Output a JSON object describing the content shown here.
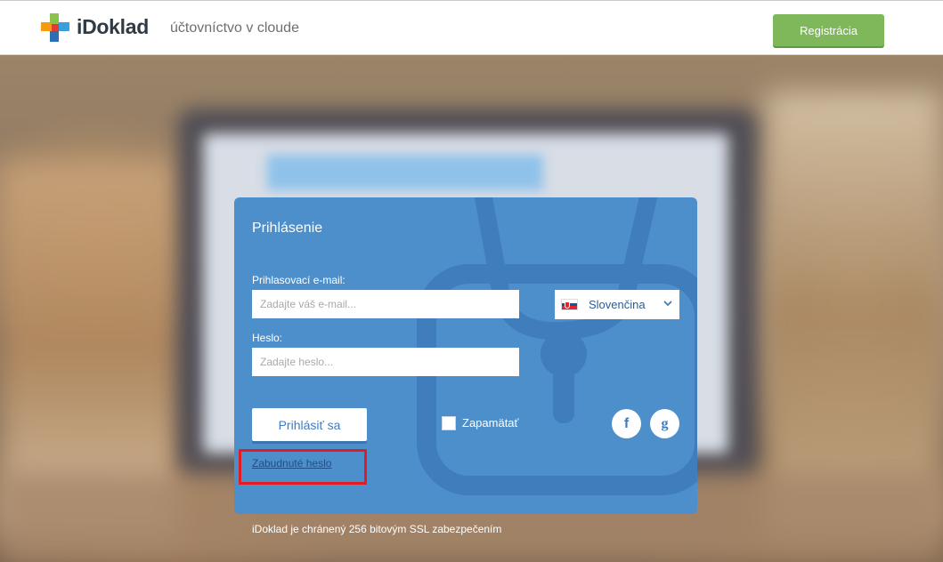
{
  "header": {
    "brand": "iDoklad",
    "tagline": "účtovníctvo v cloude",
    "register_label": "Registrácia"
  },
  "login": {
    "title": "Prihlásenie",
    "email_label": "Prihlasovací e-mail:",
    "email_placeholder": "Zadajte váš e-mail...",
    "email_value": "",
    "password_label": "Heslo:",
    "password_placeholder": "Zadajte heslo...",
    "password_value": "",
    "language": "Slovenčina",
    "submit_label": "Prihlásiť sa",
    "remember_label": "Zapamätať",
    "remember_checked": false,
    "facebook_glyph": "f",
    "google_glyph": "g",
    "forgot_label": "Zabudnuté heslo"
  },
  "footer": {
    "ssl_note": "iDoklad je chránený 256 bitovým SSL zabezpečením"
  },
  "colors": {
    "panel": "#4d8fcb",
    "register_button": "#7fb85b",
    "highlight": "#e31b23"
  },
  "icons": [
    "idoklad-logo-icon",
    "slovak-flag-icon",
    "chevron-down-icon",
    "facebook-icon",
    "google-icon",
    "padlock-icon"
  ]
}
